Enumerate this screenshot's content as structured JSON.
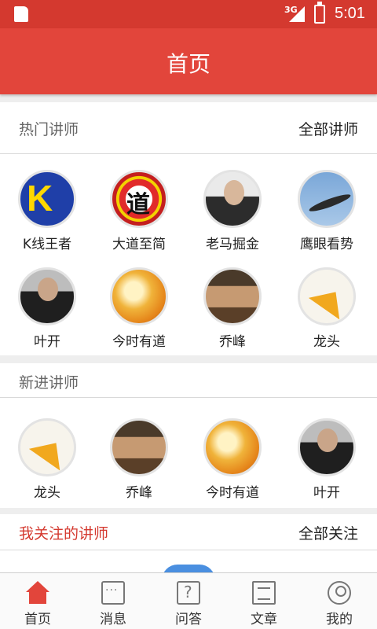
{
  "status_bar": {
    "network": "3G",
    "time": "5:01"
  },
  "header": {
    "title": "首页"
  },
  "hot": {
    "title": "热门讲师",
    "more": "全部讲师",
    "teachers": [
      {
        "name": "K线王者",
        "avatar": "k"
      },
      {
        "name": "大道至简",
        "avatar": "dao"
      },
      {
        "name": "老马掘金",
        "avatar": "ma"
      },
      {
        "name": "鹰眼看势",
        "avatar": "eagle"
      },
      {
        "name": "叶开",
        "avatar": "ye"
      },
      {
        "name": "今时有道",
        "avatar": "jin"
      },
      {
        "name": "乔峰",
        "avatar": "qiao"
      },
      {
        "name": "龙头",
        "avatar": "long"
      }
    ]
  },
  "new": {
    "title": "新进讲师",
    "teachers": [
      {
        "name": "龙头",
        "avatar": "long"
      },
      {
        "name": "乔峰",
        "avatar": "qiao"
      },
      {
        "name": "今时有道",
        "avatar": "jin"
      },
      {
        "name": "叶开",
        "avatar": "ye"
      }
    ]
  },
  "follow": {
    "title": "我关注的讲师",
    "more": "全部关注"
  },
  "tabs": [
    {
      "label": "首页",
      "icon": "home-icon",
      "active": true
    },
    {
      "label": "消息",
      "icon": "message-icon",
      "active": false
    },
    {
      "label": "问答",
      "icon": "qa-icon",
      "active": false
    },
    {
      "label": "文章",
      "icon": "article-icon",
      "active": false
    },
    {
      "label": "我的",
      "icon": "profile-icon",
      "active": false
    }
  ],
  "colors": {
    "brand": "#e2453b",
    "accent_text": "#d4392f"
  }
}
